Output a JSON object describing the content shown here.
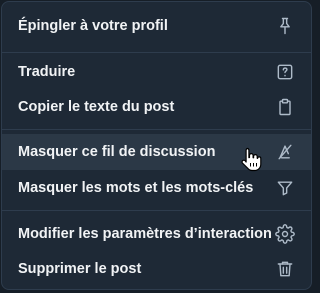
{
  "menu": {
    "items": [
      {
        "label": "Épingler à votre profil",
        "icon": "pin-icon"
      },
      {
        "label": "Traduire",
        "icon": "translate-icon"
      },
      {
        "label": "Copier le texte du post",
        "icon": "clipboard-icon"
      },
      {
        "label": "Masquer ce fil de discussion",
        "icon": "mute-thread-icon",
        "hovered": true
      },
      {
        "label": "Masquer les mots et les mots-clés",
        "icon": "filter-icon"
      },
      {
        "label": "Modifier les paramètres d’interaction",
        "icon": "gear-icon"
      },
      {
        "label": "Supprimer le post",
        "icon": "trash-icon"
      }
    ]
  },
  "colors": {
    "background": "#1e2936",
    "hover": "#2b3846",
    "divider": "#2e3c4d",
    "text": "#f1f3f5",
    "icon": "#aebbc9"
  }
}
